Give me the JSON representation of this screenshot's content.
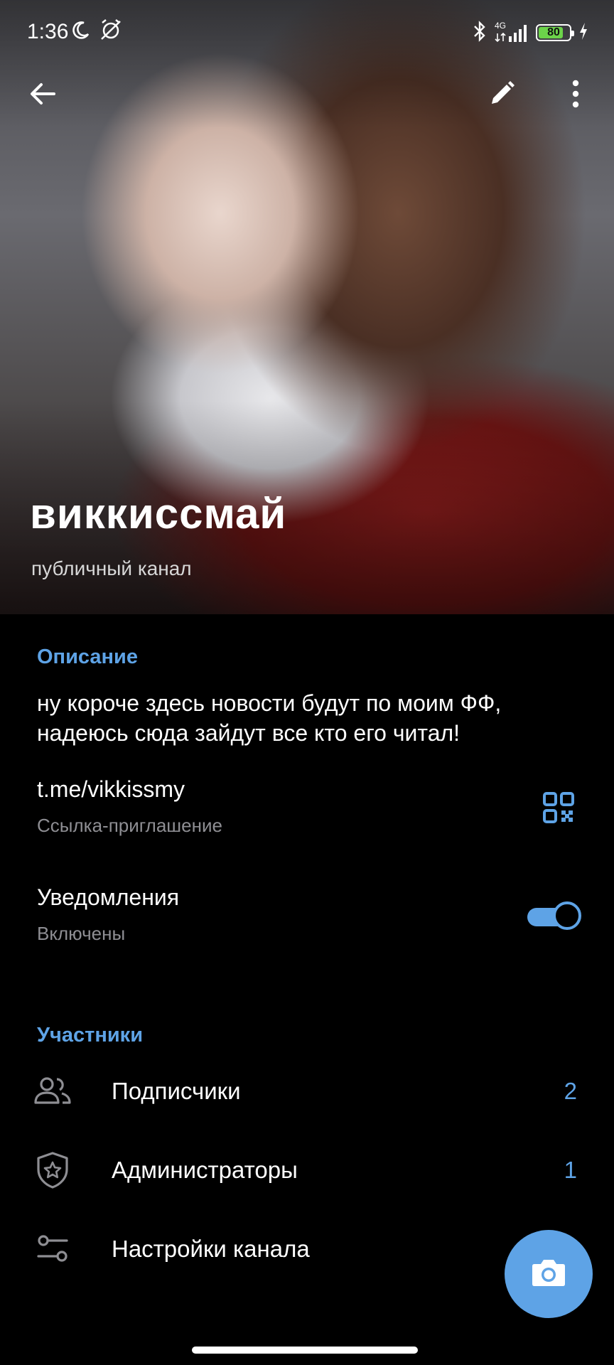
{
  "status_bar": {
    "time": "1:36",
    "network": "4G",
    "battery": "80",
    "battery_level": 0.8
  },
  "header": {
    "title": "виккиссмай",
    "subtitle": "публичный канал"
  },
  "toolbar": {
    "back_icon": "back-arrow-icon",
    "edit_icon": "pencil-icon",
    "more_icon": "more-vertical-icon"
  },
  "description": {
    "header": "Описание",
    "text_line1": "ну короче здесь новости будут по моим ФФ,",
    "text_line2": "надеюсь сюда зайдут все кто его читал!"
  },
  "link": {
    "url": "t.me/vikkissmy",
    "label": "Ссылка-приглашение"
  },
  "notifications": {
    "title": "Уведомления",
    "status": "Включены",
    "enabled": true
  },
  "members": {
    "header": "Участники",
    "items": [
      {
        "label": "Подписчики",
        "count": "2",
        "icon": "users-icon"
      },
      {
        "label": "Администраторы",
        "count": "1",
        "icon": "shield-star-icon"
      },
      {
        "label": "Настройки канала",
        "count": "",
        "icon": "sliders-icon"
      }
    ]
  },
  "colors": {
    "accent": "#5ea3e6",
    "background": "#000000",
    "secondary_text": "#8e8e93"
  }
}
